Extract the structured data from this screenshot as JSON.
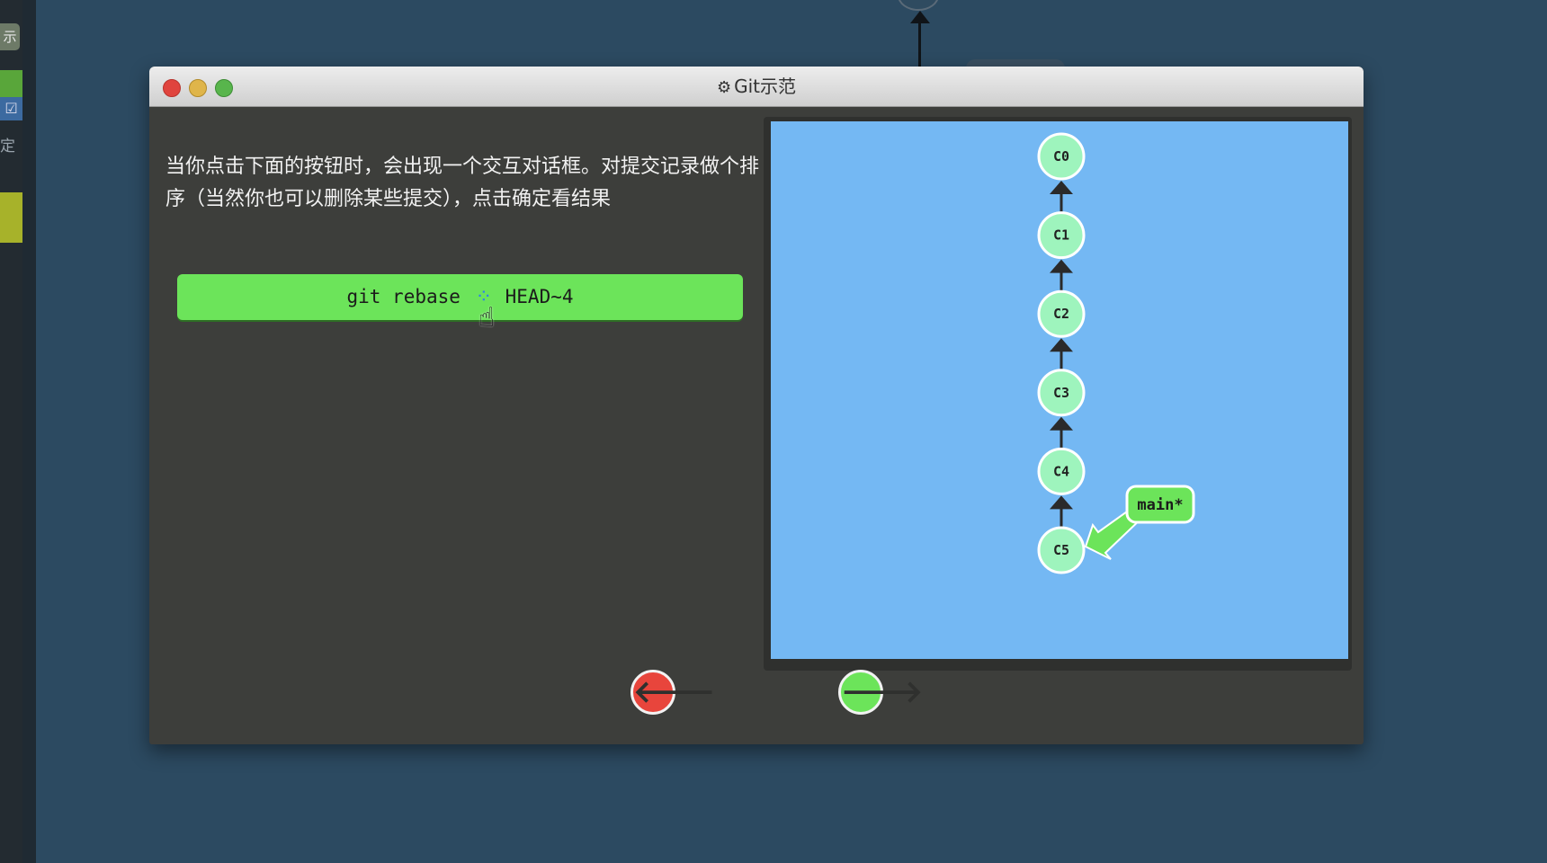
{
  "window": {
    "title": "Git示范",
    "title_icon": "gear-icon"
  },
  "instruction": "当你点击下面的按钮时，会出现一个交互对话框。对提交记录做个排序（当然你也可以删除某些提交），点击确定看结果",
  "command_button": {
    "prefix": "git rebase ",
    "flag_hidden_by_spinner": "-i",
    "suffix": " HEAD~4",
    "color": "#6ce45a"
  },
  "graph": {
    "background": "#74b8f3",
    "commits": [
      "C0",
      "C1",
      "C2",
      "C3",
      "C4",
      "C5"
    ],
    "branch": {
      "name": "main*",
      "points_to": "C5"
    },
    "commit_color": "#9ef4bd"
  },
  "nav": {
    "prev_icon": "arrow-left-icon",
    "next_icon": "arrow-right-icon",
    "prev_glyph": "🡐",
    "next_glyph": "🡒",
    "prev_color": "#e8453c",
    "next_color": "#6ce45a"
  },
  "background_ui": {
    "left_button_label": "示",
    "left_text": "定"
  }
}
